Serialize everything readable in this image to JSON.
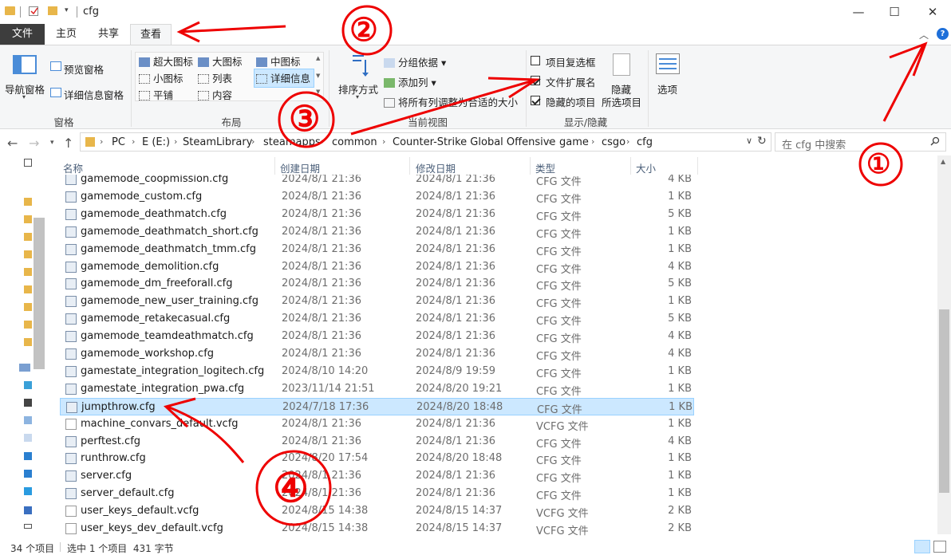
{
  "window": {
    "title": "cfg",
    "controls": {
      "minimize": "—",
      "maximize": "☐",
      "close": "✕"
    }
  },
  "tabs": [
    {
      "label": "文件",
      "id": "file"
    },
    {
      "label": "主页",
      "id": "home"
    },
    {
      "label": "共享",
      "id": "share"
    },
    {
      "label": "查看",
      "id": "view",
      "active": true
    }
  ],
  "ribbon": {
    "panes": {
      "nav_pane": "导航窗格",
      "preview_pane": "预览窗格",
      "details_pane": "详细信息窗格",
      "group_label": "窗格"
    },
    "layout": {
      "items": [
        "超大图标",
        "大图标",
        "中图标",
        "小图标",
        "列表",
        "详细信息",
        "平铺",
        "内容"
      ],
      "selected": "详细信息",
      "group_label": "布局"
    },
    "current_view": {
      "sort_by": "排序方式",
      "group_by": "分组依据",
      "add_columns": "添加列",
      "fit_columns": "将所有列调整为合适的大小",
      "group_label": "当前视图"
    },
    "show_hide": {
      "item_checkboxes": {
        "label": "项目复选框",
        "checked": false
      },
      "file_extensions": {
        "label": "文件扩展名",
        "checked": true
      },
      "hidden_items": {
        "label": "隐藏的项目",
        "checked": true
      },
      "hide_selected_1": "隐藏",
      "hide_selected_2": "所选项目",
      "options": "选项",
      "group_label": "显示/隐藏"
    }
  },
  "address": {
    "crumbs": [
      "PC",
      "E (E:)",
      "SteamLibrary",
      "steamapps",
      "common",
      "Counter-Strike Global Offensive",
      "game",
      "csgo",
      "cfg"
    ],
    "search_placeholder": "在 cfg 中搜索"
  },
  "columns": {
    "name": "名称",
    "created": "创建日期",
    "modified": "修改日期",
    "type": "类型",
    "size": "大小"
  },
  "files": [
    {
      "name": "gamemode_coopmission.cfg",
      "created": "2024/8/1 21:36",
      "modified": "2024/8/1 21:36",
      "type": "CFG 文件",
      "size": "4 KB",
      "icon": "cfg"
    },
    {
      "name": "gamemode_custom.cfg",
      "created": "2024/8/1 21:36",
      "modified": "2024/8/1 21:36",
      "type": "CFG 文件",
      "size": "1 KB",
      "icon": "cfg"
    },
    {
      "name": "gamemode_deathmatch.cfg",
      "created": "2024/8/1 21:36",
      "modified": "2024/8/1 21:36",
      "type": "CFG 文件",
      "size": "5 KB",
      "icon": "cfg"
    },
    {
      "name": "gamemode_deathmatch_short.cfg",
      "created": "2024/8/1 21:36",
      "modified": "2024/8/1 21:36",
      "type": "CFG 文件",
      "size": "1 KB",
      "icon": "cfg"
    },
    {
      "name": "gamemode_deathmatch_tmm.cfg",
      "created": "2024/8/1 21:36",
      "modified": "2024/8/1 21:36",
      "type": "CFG 文件",
      "size": "1 KB",
      "icon": "cfg"
    },
    {
      "name": "gamemode_demolition.cfg",
      "created": "2024/8/1 21:36",
      "modified": "2024/8/1 21:36",
      "type": "CFG 文件",
      "size": "4 KB",
      "icon": "cfg"
    },
    {
      "name": "gamemode_dm_freeforall.cfg",
      "created": "2024/8/1 21:36",
      "modified": "2024/8/1 21:36",
      "type": "CFG 文件",
      "size": "5 KB",
      "icon": "cfg"
    },
    {
      "name": "gamemode_new_user_training.cfg",
      "created": "2024/8/1 21:36",
      "modified": "2024/8/1 21:36",
      "type": "CFG 文件",
      "size": "1 KB",
      "icon": "cfg"
    },
    {
      "name": "gamemode_retakecasual.cfg",
      "created": "2024/8/1 21:36",
      "modified": "2024/8/1 21:36",
      "type": "CFG 文件",
      "size": "5 KB",
      "icon": "cfg"
    },
    {
      "name": "gamemode_teamdeathmatch.cfg",
      "created": "2024/8/1 21:36",
      "modified": "2024/8/1 21:36",
      "type": "CFG 文件",
      "size": "4 KB",
      "icon": "cfg"
    },
    {
      "name": "gamemode_workshop.cfg",
      "created": "2024/8/1 21:36",
      "modified": "2024/8/1 21:36",
      "type": "CFG 文件",
      "size": "4 KB",
      "icon": "cfg"
    },
    {
      "name": "gamestate_integration_logitech.cfg",
      "created": "2024/8/10 14:20",
      "modified": "2024/8/9 19:59",
      "type": "CFG 文件",
      "size": "1 KB",
      "icon": "cfg"
    },
    {
      "name": "gamestate_integration_pwa.cfg",
      "created": "2023/11/14 21:51",
      "modified": "2024/8/20 19:21",
      "type": "CFG 文件",
      "size": "1 KB",
      "icon": "cfg"
    },
    {
      "name": "jumpthrow.cfg",
      "created": "2024/7/18 17:36",
      "modified": "2024/8/20 18:48",
      "type": "CFG 文件",
      "size": "1 KB",
      "icon": "cfg",
      "selected": true
    },
    {
      "name": "machine_convars_default.vcfg",
      "created": "2024/8/1 21:36",
      "modified": "2024/8/1 21:36",
      "type": "VCFG 文件",
      "size": "1 KB",
      "icon": "plain"
    },
    {
      "name": "perftest.cfg",
      "created": "2024/8/1 21:36",
      "modified": "2024/8/1 21:36",
      "type": "CFG 文件",
      "size": "4 KB",
      "icon": "cfg"
    },
    {
      "name": "runthrow.cfg",
      "created": "2024/8/20 17:54",
      "modified": "2024/8/20 18:48",
      "type": "CFG 文件",
      "size": "1 KB",
      "icon": "cfg"
    },
    {
      "name": "server.cfg",
      "created": "2024/8/1 21:36",
      "modified": "2024/8/1 21:36",
      "type": "CFG 文件",
      "size": "1 KB",
      "icon": "cfg"
    },
    {
      "name": "server_default.cfg",
      "created": "2024/8/1 21:36",
      "modified": "2024/8/1 21:36",
      "type": "CFG 文件",
      "size": "1 KB",
      "icon": "cfg"
    },
    {
      "name": "user_keys_default.vcfg",
      "created": "2024/8/15 14:38",
      "modified": "2024/8/15 14:37",
      "type": "VCFG 文件",
      "size": "2 KB",
      "icon": "plain"
    },
    {
      "name": "user_keys_dev_default.vcfg",
      "created": "2024/8/15 14:38",
      "modified": "2024/8/15 14:37",
      "type": "VCFG 文件",
      "size": "2 KB",
      "icon": "plain"
    }
  ],
  "status": {
    "count": "34 个项目",
    "selection": "选中 1 个项目  431 字节"
  },
  "annotations": [
    "①",
    "②",
    "③",
    "④"
  ],
  "colors": {
    "file_tab": "#3d3d3d",
    "selection": "#cce8ff",
    "annotation": "#e00000",
    "help": "#1e6fd9"
  }
}
